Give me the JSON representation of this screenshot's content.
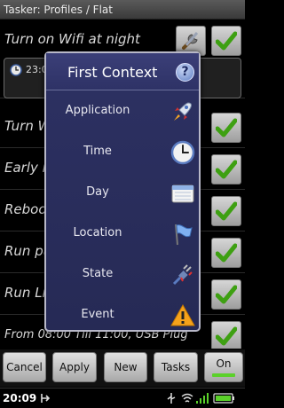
{
  "app": {
    "title": "Tasker: Profiles / Flat"
  },
  "profiles": [
    {
      "name": "Turn on Wifi at night"
    },
    {
      "name": "Turn Wifi off"
    },
    {
      "name": "Early morning reboot"
    },
    {
      "name": "Reboot to recovery"
    },
    {
      "name": "Run push up app"
    },
    {
      "name": "Run Libra"
    },
    {
      "name": "From 08:00 Till 11:00, USB Plug"
    }
  ],
  "expanded_context": {
    "time": "23:0"
  },
  "dialog": {
    "title": "First Context",
    "help_glyph": "?",
    "options": [
      {
        "label": "Application",
        "icon": "rocket-icon"
      },
      {
        "label": "Time",
        "icon": "clock-icon"
      },
      {
        "label": "Day",
        "icon": "calendar-icon"
      },
      {
        "label": "Location",
        "icon": "flag-icon"
      },
      {
        "label": "State",
        "icon": "plug-icon"
      },
      {
        "label": "Event",
        "icon": "warning-icon"
      }
    ]
  },
  "buttons": {
    "cancel": "Cancel",
    "apply": "Apply",
    "new": "New",
    "tasks": "Tasks",
    "on": "On"
  },
  "status": {
    "time": "20:09"
  },
  "colors": {
    "accent_green": "#5bd12a",
    "dialog_bg": "#2d3163"
  }
}
